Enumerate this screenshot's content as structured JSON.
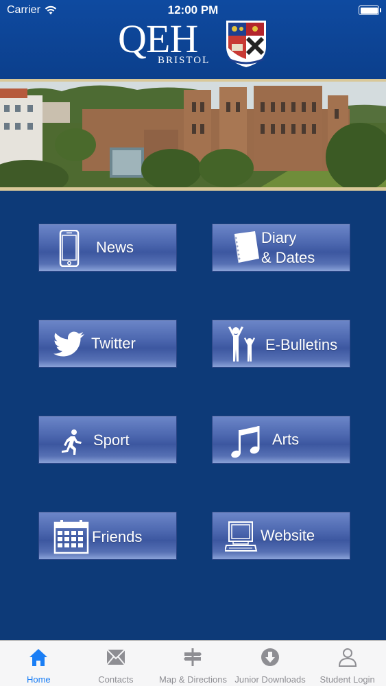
{
  "status": {
    "carrier": "Carrier",
    "time": "12:00 PM"
  },
  "header": {
    "logo_main": "QEH",
    "logo_sub": "BRISTOL"
  },
  "menu": {
    "news": "News",
    "diary_line1": "Diary",
    "diary_line2": "& Dates",
    "twitter": "Twitter",
    "ebulletins": "E-Bulletins",
    "sport": "Sport",
    "arts": "Arts",
    "friends": "Friends",
    "website": "Website"
  },
  "tabs": [
    {
      "label": "Home",
      "icon": "home-icon",
      "active": true
    },
    {
      "label": "Contacts",
      "icon": "envelope-icon",
      "active": false
    },
    {
      "label": "Map & Directions",
      "icon": "signpost-icon",
      "active": false
    },
    {
      "label": "Junior Downloads",
      "icon": "download-icon",
      "active": false
    },
    {
      "label": "Student Login",
      "icon": "person-icon",
      "active": false
    }
  ],
  "colors": {
    "background": "#0d3a78",
    "header": "#0e4aa0",
    "accent_gold": "#d9c899",
    "tab_active": "#1a7ef5",
    "tab_inactive": "#8e8e93"
  }
}
